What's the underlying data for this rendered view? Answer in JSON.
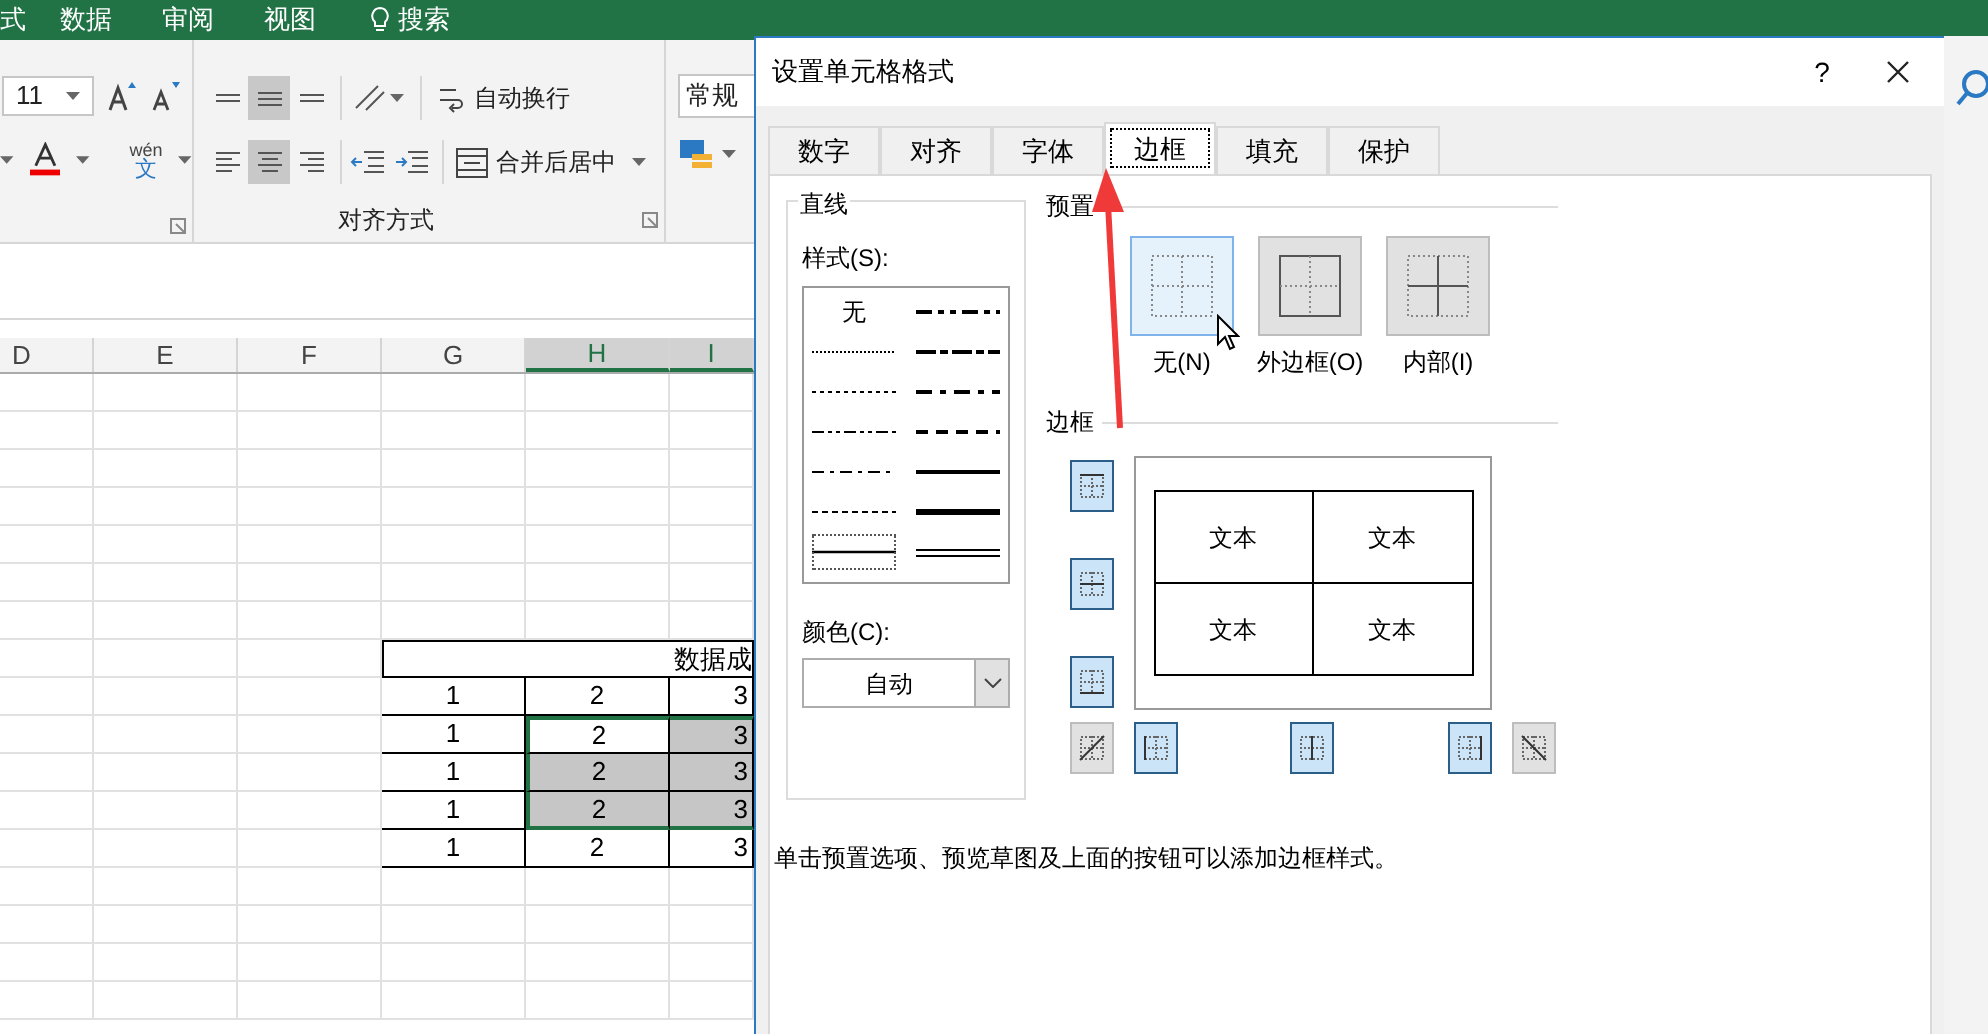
{
  "ribbon_tabs": [
    {
      "label": "式",
      "selected": false
    },
    {
      "label": "数据",
      "selected": false
    },
    {
      "label": "审阅",
      "selected": false
    },
    {
      "label": "视图",
      "selected": false
    }
  ],
  "search": {
    "label": "搜索"
  },
  "ribbon": {
    "font_size": "11",
    "phonetic": {
      "top": "wén",
      "bottom": "文"
    },
    "vertical_align": [
      {
        "kind": "top",
        "selected": false
      },
      {
        "kind": "middle",
        "selected": true
      },
      {
        "kind": "bottom",
        "selected": false
      }
    ],
    "horizontal_align": [
      {
        "kind": "left",
        "selected": false
      },
      {
        "kind": "center",
        "selected": true
      },
      {
        "kind": "right",
        "selected": false
      }
    ],
    "wrap_text": "自动换行",
    "merge_center": "合并后居中",
    "number_format": "常规",
    "group_label": "对齐方式"
  },
  "sheet": {
    "columns": [
      {
        "label": "D",
        "selected": false
      },
      {
        "label": "E",
        "selected": false
      },
      {
        "label": "F",
        "selected": false
      },
      {
        "label": "G",
        "selected": false
      },
      {
        "label": "H",
        "selected": true
      },
      {
        "label": "I",
        "selected": true
      }
    ],
    "table": {
      "title": "数据成",
      "rows": [
        [
          {
            "text": "1",
            "in_selection": false,
            "shaded": false
          },
          {
            "text": "2",
            "in_selection": false,
            "shaded": false
          },
          {
            "text": "3",
            "in_selection": false,
            "shaded": false
          }
        ],
        [
          {
            "text": "1",
            "in_selection": false,
            "shaded": false
          },
          {
            "text": "2",
            "in_selection": true,
            "shaded": false
          },
          {
            "text": "3",
            "in_selection": true,
            "shaded": true
          }
        ],
        [
          {
            "text": "1",
            "in_selection": false,
            "shaded": false
          },
          {
            "text": "2",
            "in_selection": true,
            "shaded": true
          },
          {
            "text": "3",
            "in_selection": true,
            "shaded": true
          }
        ],
        [
          {
            "text": "1",
            "in_selection": false,
            "shaded": false
          },
          {
            "text": "2",
            "in_selection": true,
            "shaded": true
          },
          {
            "text": "3",
            "in_selection": true,
            "shaded": true
          }
        ],
        [
          {
            "text": "1",
            "in_selection": false,
            "shaded": false
          },
          {
            "text": "2",
            "in_selection": false,
            "shaded": false
          },
          {
            "text": "3",
            "in_selection": false,
            "shaded": false
          }
        ]
      ]
    }
  },
  "dialog": {
    "title": "设置单元格格式",
    "help": "?",
    "tabs": [
      {
        "label": "数字",
        "selected": false
      },
      {
        "label": "对齐",
        "selected": false
      },
      {
        "label": "字体",
        "selected": false
      },
      {
        "label": "边框",
        "selected": true
      },
      {
        "label": "填充",
        "selected": false
      },
      {
        "label": "保护",
        "selected": false
      }
    ],
    "line": {
      "heading": "直线",
      "style_label": "样式(S):",
      "styles": [
        [
          {
            "kind": "none",
            "label": "无",
            "selected": false
          },
          {
            "kind": "hair",
            "selected": false
          },
          {
            "kind": "dotted",
            "selected": false
          },
          {
            "kind": "dash_dot_dot",
            "selected": false
          },
          {
            "kind": "dash_dot",
            "selected": false
          },
          {
            "kind": "dashed",
            "selected": false
          },
          {
            "kind": "thin",
            "selected": true
          }
        ],
        [
          {
            "kind": "medium_dash_dot_dot",
            "selected": false
          },
          {
            "kind": "slant_dash_dot",
            "selected": false
          },
          {
            "kind": "medium_dash_dot",
            "selected": false
          },
          {
            "kind": "medium_dashed",
            "selected": false
          },
          {
            "kind": "medium",
            "selected": false
          },
          {
            "kind": "thick",
            "selected": false
          },
          {
            "kind": "double",
            "selected": false
          }
        ]
      ],
      "color_label": "颜色(C):",
      "color_value": "自动"
    },
    "presets": {
      "heading": "预置",
      "items": [
        {
          "kind": "none",
          "label": "无(N)",
          "selected": true
        },
        {
          "kind": "outline",
          "label": "外边框(O)",
          "selected": false
        },
        {
          "kind": "inside",
          "label": "内部(I)",
          "selected": false
        }
      ]
    },
    "border": {
      "heading": "边框",
      "left_buttons": [
        {
          "kind": "top",
          "on": true
        },
        {
          "kind": "middle_h",
          "on": true
        },
        {
          "kind": "bottom",
          "on": true
        }
      ],
      "bottom_buttons": [
        {
          "kind": "diag_up",
          "on": false
        },
        {
          "kind": "left",
          "on": true
        },
        {
          "kind": "middle_v",
          "on": true
        },
        {
          "kind": "right",
          "on": true
        },
        {
          "kind": "diag_down",
          "on": false
        }
      ],
      "preview_cells": [
        "文本",
        "文本",
        "文本",
        "文本"
      ]
    },
    "hint": "单击预置选项、预览草图及上面的按钮可以添加边框样式。"
  }
}
